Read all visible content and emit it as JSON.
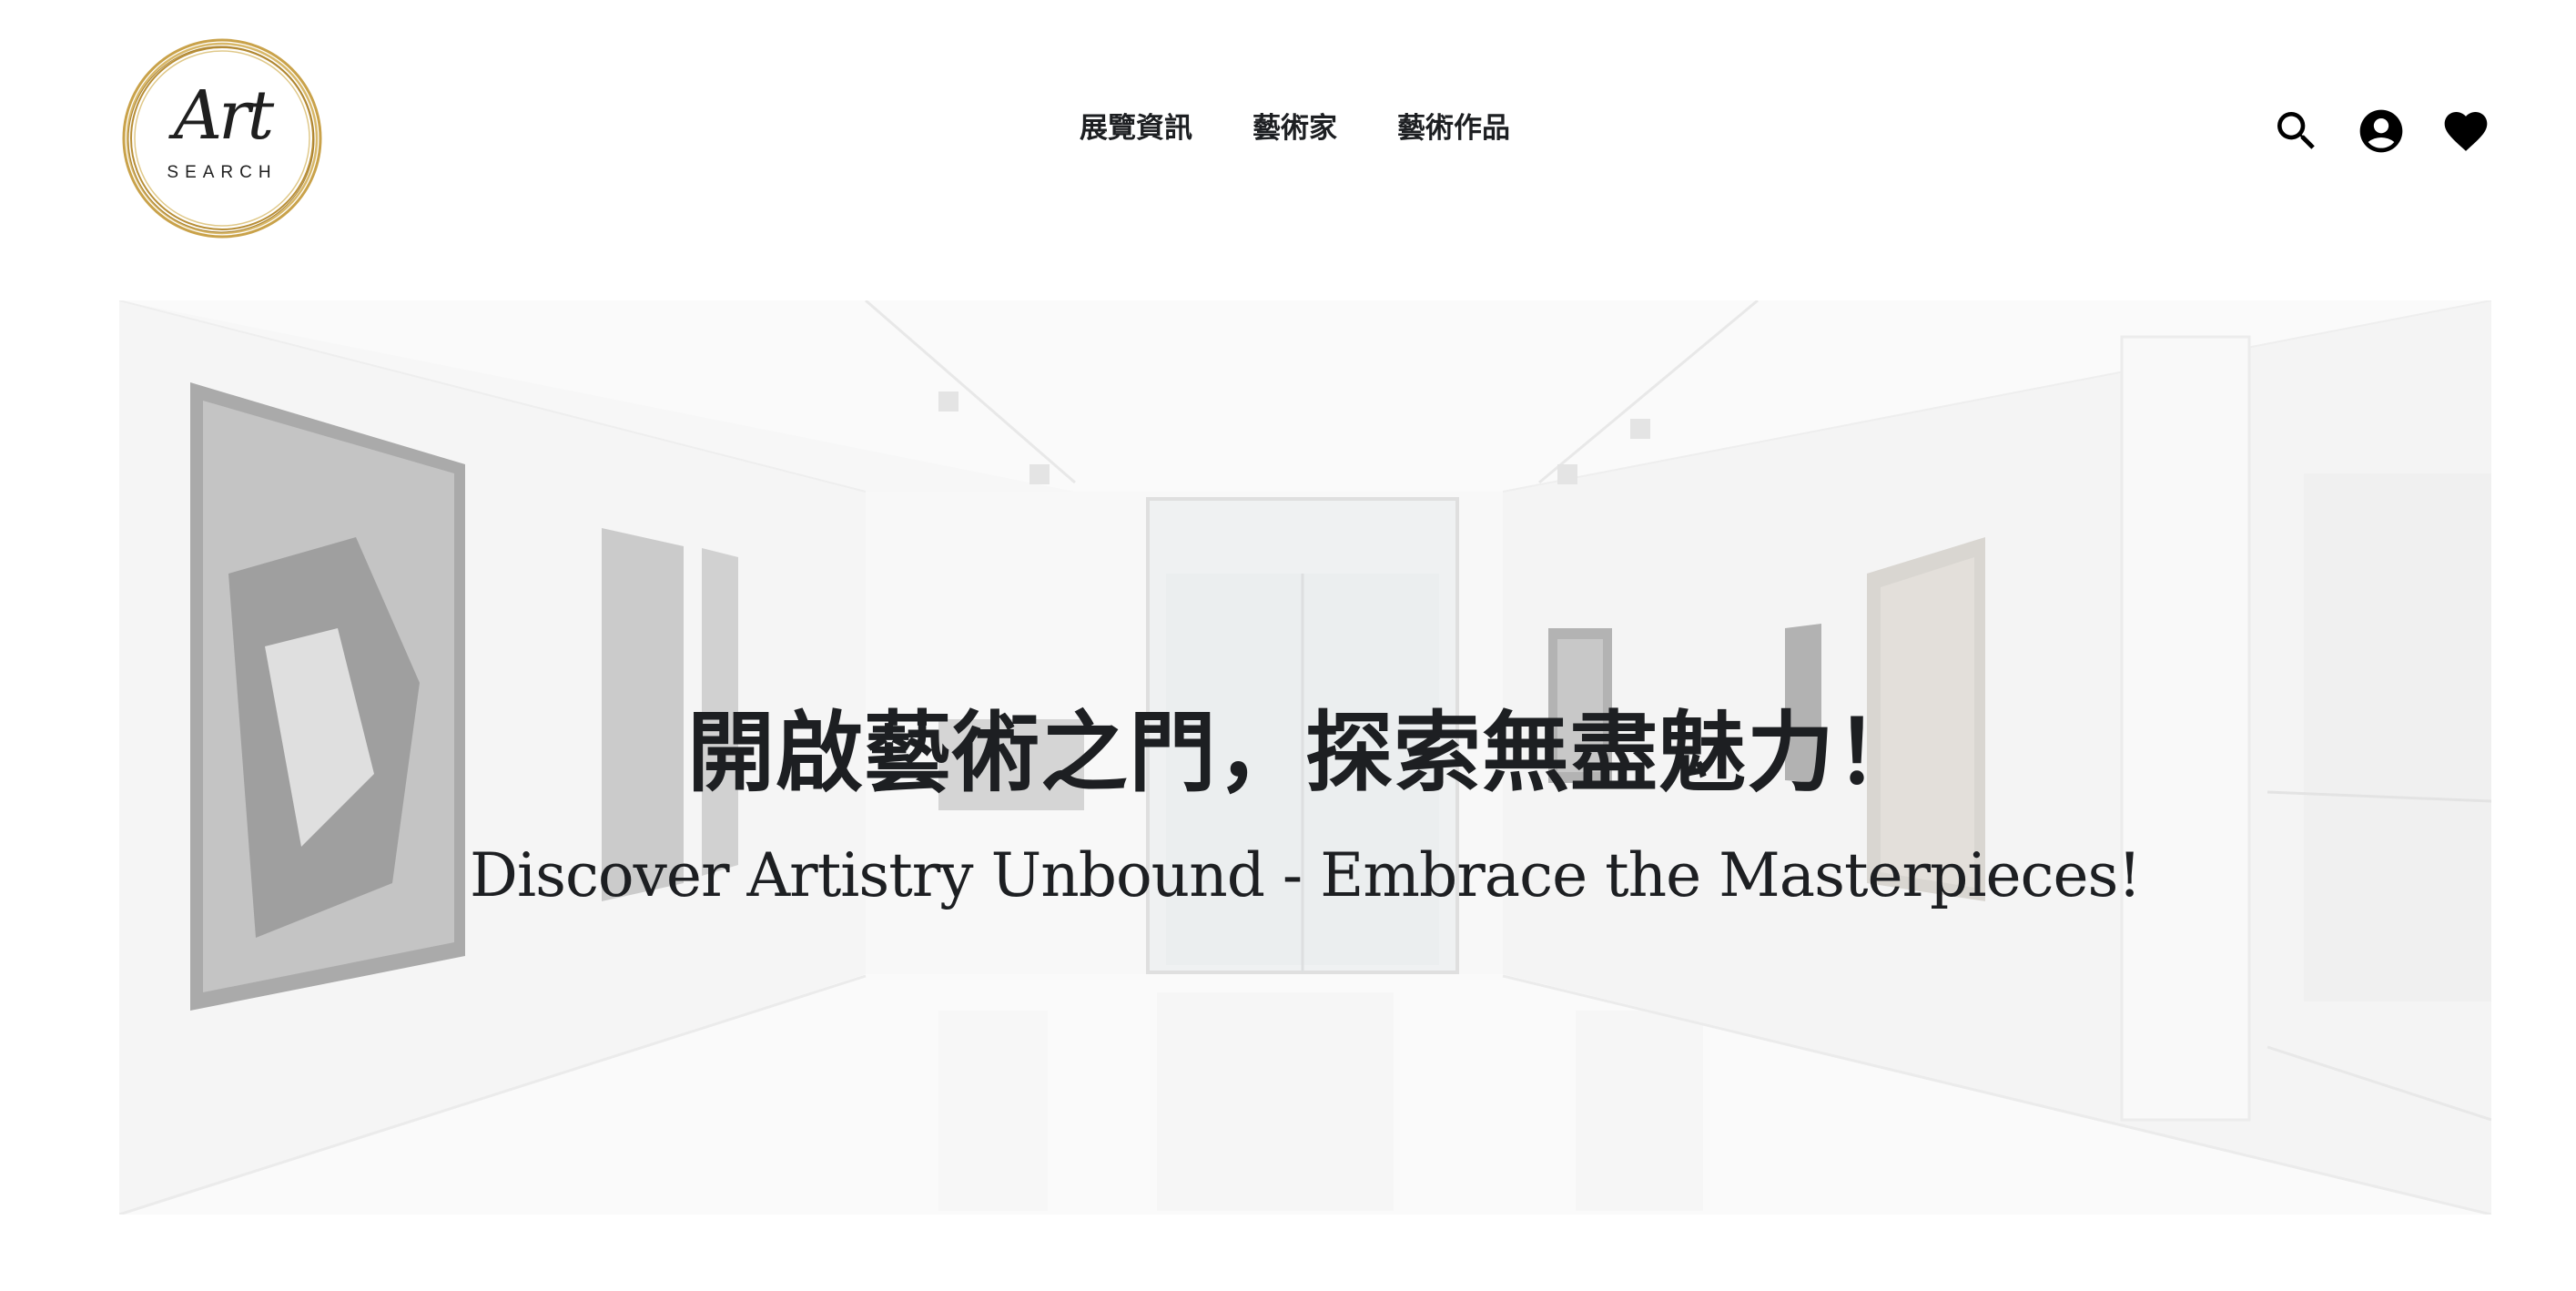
{
  "logo": {
    "script_text": "Art",
    "sub_text": "SEARCH"
  },
  "nav": {
    "items": [
      {
        "label": "展覽資訊"
      },
      {
        "label": "藝術家"
      },
      {
        "label": "藝術作品"
      }
    ]
  },
  "header_icons": [
    "search-icon",
    "account-icon",
    "favorites-heart-icon"
  ],
  "hero": {
    "title": "開啟藝術之門，探索無盡魅力！",
    "subtitle": "Discover Artistry Unbound - Embrace the Masterpieces!"
  },
  "colors": {
    "text": "#1d1f22",
    "logo_gold": "#c9a24a",
    "hero_bg": "#f1f2f2"
  }
}
